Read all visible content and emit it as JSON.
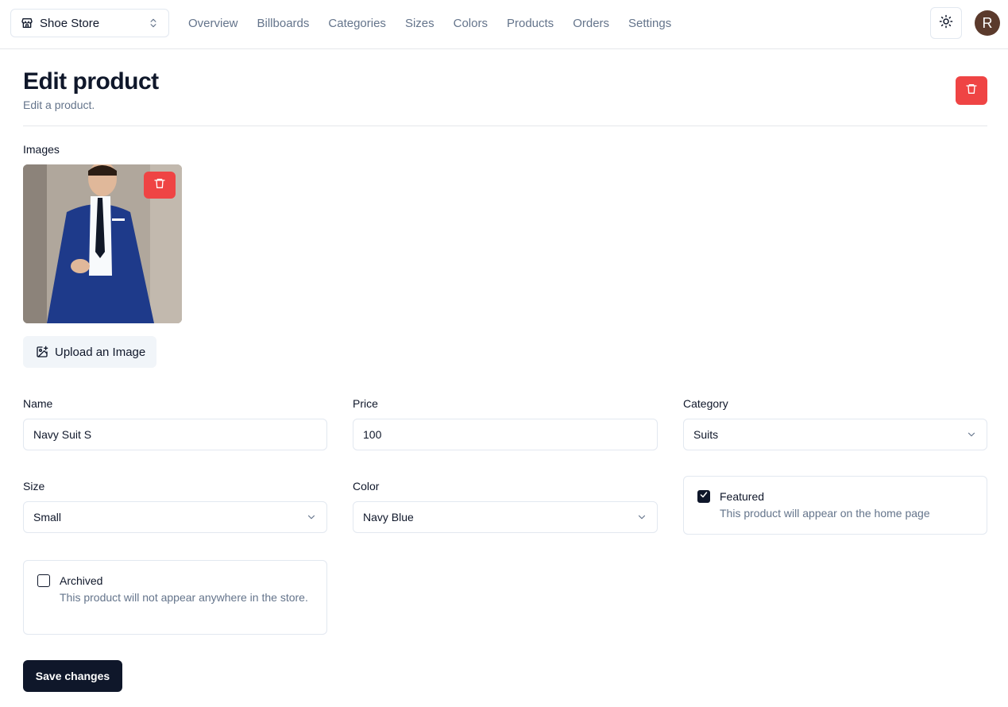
{
  "header": {
    "store_name": "Shoe Store",
    "nav": [
      "Overview",
      "Billboards",
      "Categories",
      "Sizes",
      "Colors",
      "Products",
      "Orders",
      "Settings"
    ],
    "avatar_initial": "R"
  },
  "page": {
    "title": "Edit product",
    "subtitle": "Edit a product."
  },
  "images": {
    "label": "Images",
    "upload_label": "Upload an Image"
  },
  "form": {
    "name": {
      "label": "Name",
      "value": "Navy Suit S"
    },
    "price": {
      "label": "Price",
      "value": "100"
    },
    "category": {
      "label": "Category",
      "value": "Suits"
    },
    "size": {
      "label": "Size",
      "value": "Small"
    },
    "color": {
      "label": "Color",
      "value": "Navy Blue"
    },
    "featured": {
      "title": "Featured",
      "description": "This product will appear on the home page",
      "checked": true
    },
    "archived": {
      "title": "Archived",
      "description": "This product will not appear anywhere in the store.",
      "checked": false
    },
    "save_label": "Save changes"
  },
  "colors": {
    "danger": "#ef4444",
    "primary": "#0f172a",
    "muted_text": "#64748b",
    "border": "#e2e8f0"
  },
  "icons": {
    "store": "store-icon",
    "switcher": "chevrons-up-down-icon",
    "theme": "sun-icon",
    "delete": "trash-icon",
    "upload": "image-plus-icon",
    "select": "chevron-down-icon",
    "check": "check-icon"
  }
}
